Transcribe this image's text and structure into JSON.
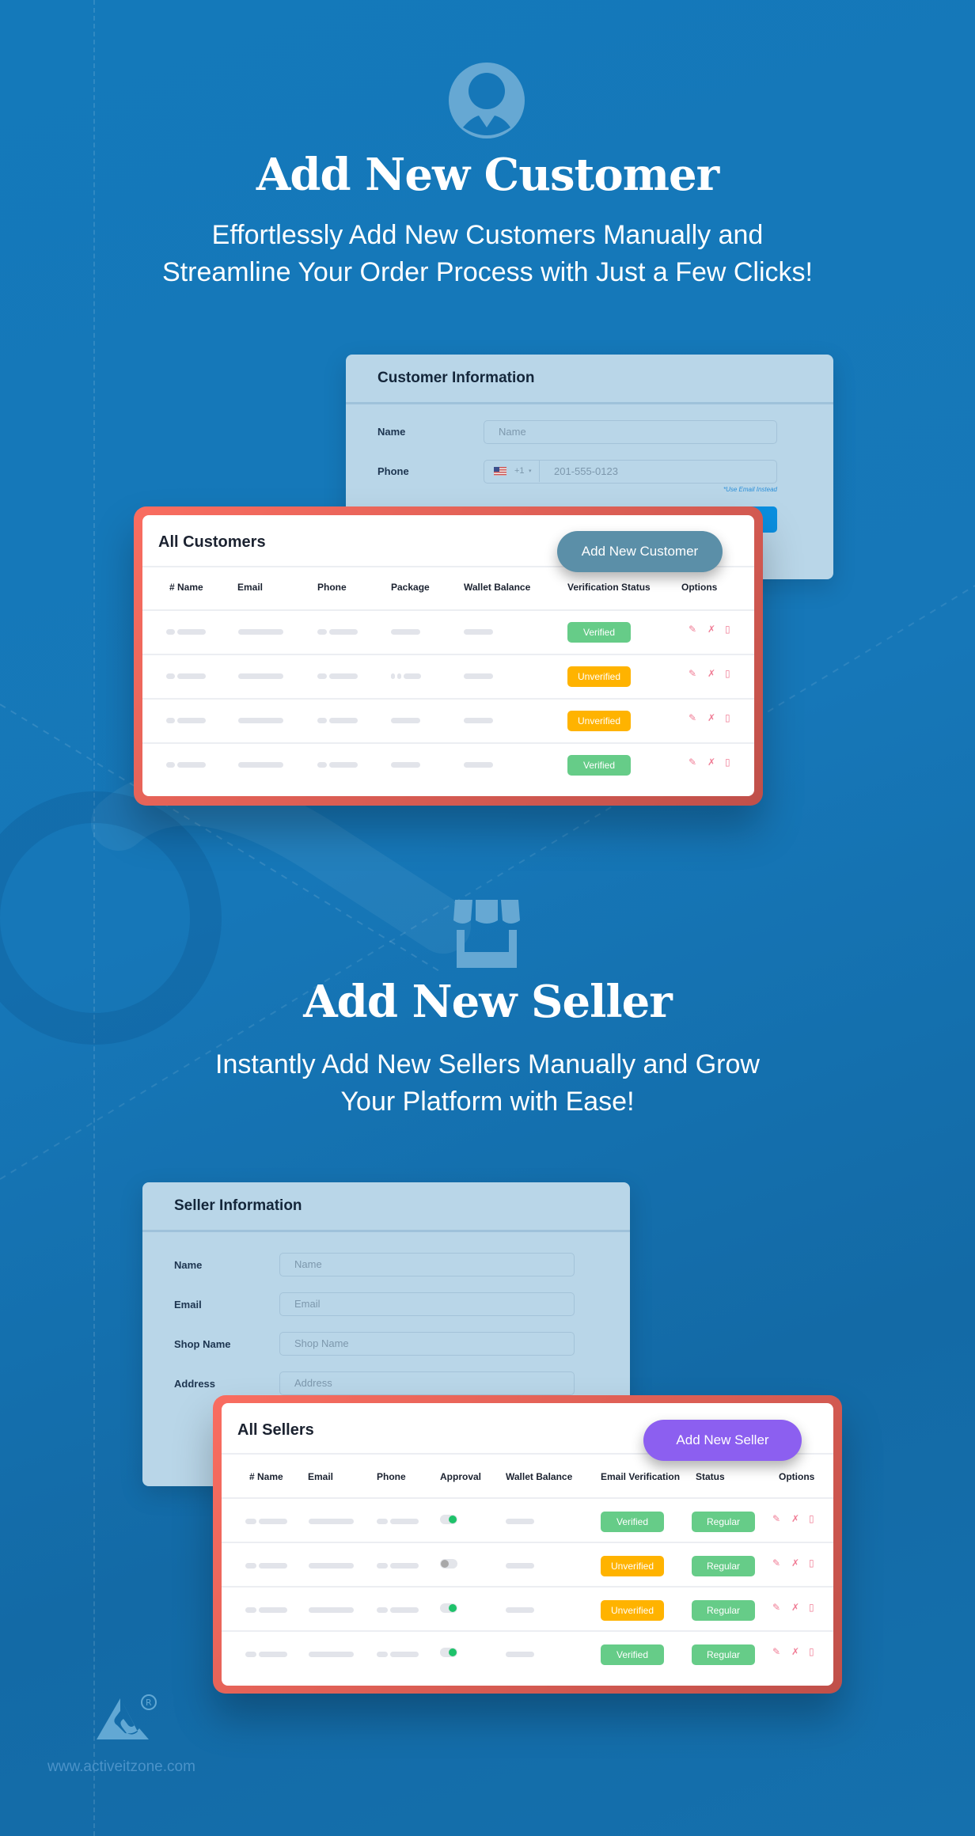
{
  "colors": {
    "background": "#1677b8",
    "verified": "#66cc88",
    "unverified": "#ffb300",
    "regular": "#66cc88",
    "customer_button": "#5b8fa8",
    "seller_button": "#8c5ff0",
    "submit_button": "#0a8fe0",
    "frame": "#f96d60",
    "toggle_on": "#1ec26a",
    "toggle_off": "#a8a8a8"
  },
  "customer_section": {
    "icon": "user-circle-icon",
    "title": "Add New Customer",
    "subtitle_lines": [
      "Effortlessly Add New Customers Manually and",
      "Streamline Your Order Process with Just a Few Clicks!"
    ],
    "form": {
      "title": "Customer Information",
      "name_label": "Name",
      "name_placeholder": "Name",
      "phone_label": "Phone",
      "country_flag": "us-flag-icon",
      "country_code": "+1",
      "phone_placeholder": "201-555-0123",
      "use_email_link": "*Use Email Instead"
    },
    "table": {
      "title": "All Customers",
      "add_button": "Add New Customer",
      "columns": [
        "# Name",
        "Email",
        "Phone",
        "Package",
        "Wallet Balance",
        "Verification Status",
        "Options"
      ],
      "rows": [
        {
          "status": "Verified"
        },
        {
          "status": "Unverified"
        },
        {
          "status": "Unverified"
        },
        {
          "status": "Verified"
        }
      ]
    }
  },
  "seller_section": {
    "icon": "storefront-icon",
    "title": "Add New Seller",
    "subtitle_lines": [
      "Instantly Add New Sellers Manually and Grow",
      "Your Platform with Ease!"
    ],
    "form": {
      "title": "Seller Information",
      "fields": [
        {
          "label": "Name",
          "placeholder": "Name"
        },
        {
          "label": "Email",
          "placeholder": "Email"
        },
        {
          "label": "Shop Name",
          "placeholder": "Shop Name"
        },
        {
          "label": "Address",
          "placeholder": "Address"
        }
      ]
    },
    "table": {
      "title": "All Sellers",
      "add_button": "Add New Seller",
      "columns": [
        "# Name",
        "Email",
        "Phone",
        "Approval",
        "Wallet Balance",
        "Email Verification",
        "Status",
        "Options"
      ],
      "rows": [
        {
          "approved": true,
          "email_verification": "Verified",
          "status": "Regular"
        },
        {
          "approved": false,
          "email_verification": "Unverified",
          "status": "Regular"
        },
        {
          "approved": true,
          "email_verification": "Unverified",
          "status": "Regular"
        },
        {
          "approved": true,
          "email_verification": "Verified",
          "status": "Regular"
        }
      ]
    }
  },
  "footer": {
    "logo": "activeitzone-logo",
    "website": "www.activeitzone.com"
  }
}
